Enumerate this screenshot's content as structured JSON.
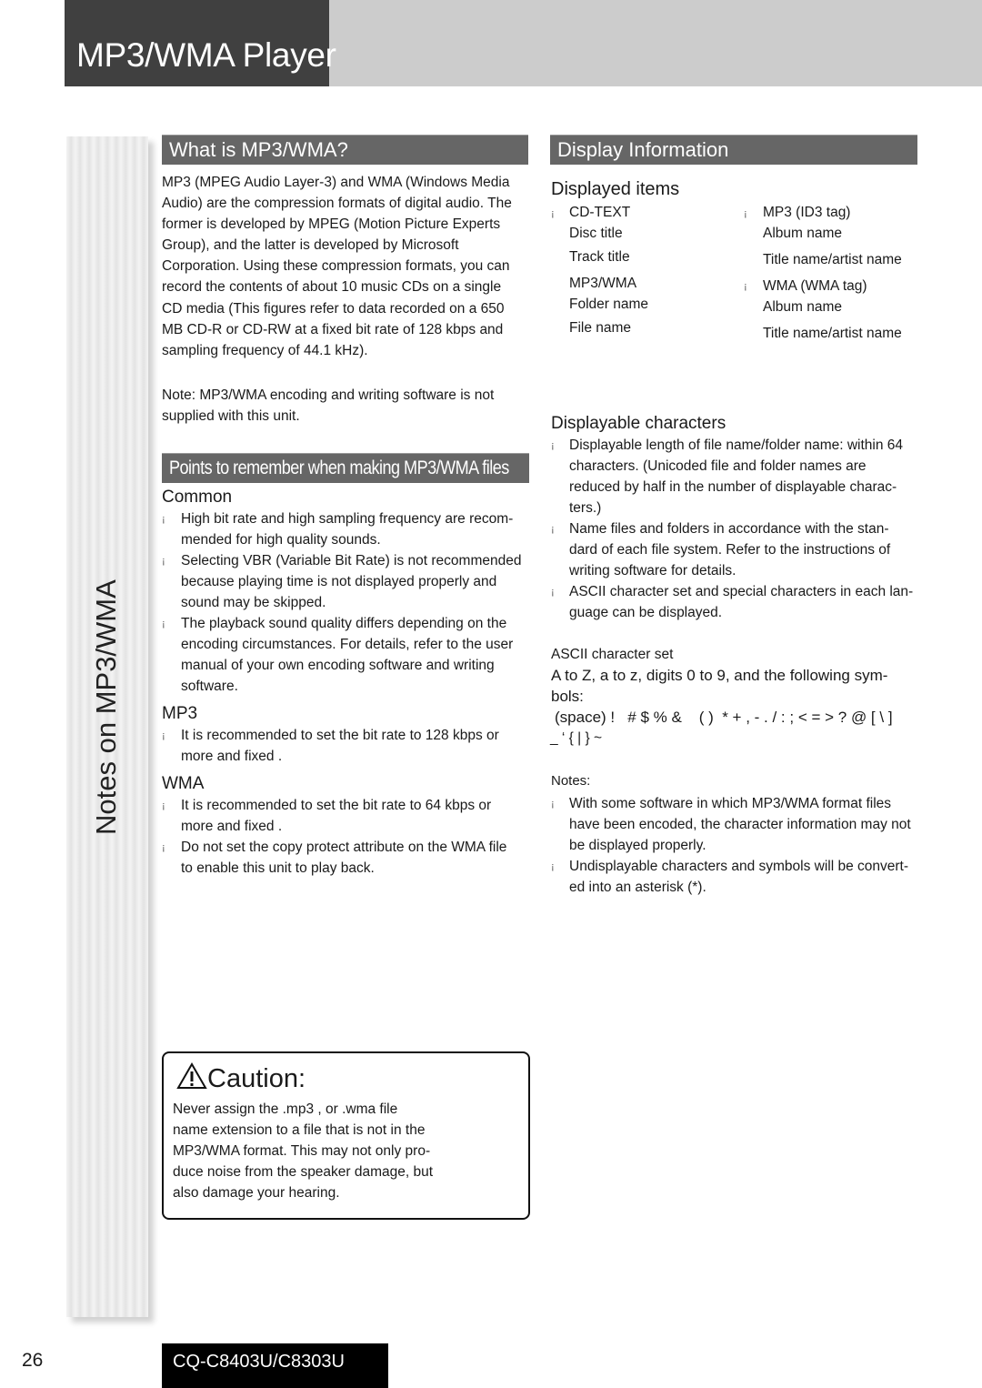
{
  "header": {
    "title": "MP3/WMA Player"
  },
  "sidebar": {
    "label": "Notes on MP3/WMA"
  },
  "what_is": {
    "heading": "What is MP3/WMA?",
    "paragraph": "MP3 (MPEG Audio Layer-3) and WMA (Windows Media\nAudio) are the compression formats of digital audio. The\nformer is developed by MPEG (Motion Picture Experts\nGroup), and the latter is developed by Microsoft\nCorporation. Using these compression formats, you can\nrecord the contents of about 10 music CDs on a single\nCD media (This figures refer to data recorded on a 650\nMB CD-R or CD-RW at a fixed bit rate of 128 kbps and\nsampling frequency of 44.1 kHz).",
    "trademark": "™",
    "note": "Note:  MP3/WMA encoding and writing software is not\nsupplied with this unit."
  },
  "points": {
    "heading": "Points to remember when making MP3/WMA files",
    "common": {
      "title": "Common",
      "items": [
        "High bit rate and high sampling frequency are recom-\nmended for high quality sounds.",
        "Selecting VBR (Variable Bit Rate) is not recommended\nbecause playing time is not displayed properly and\nsound may be skipped.",
        "The playback sound quality differs depending on the\nencoding circumstances. For details, refer to the user\nmanual of your own encoding software and writing\nsoftware."
      ]
    },
    "mp3": {
      "title": "MP3",
      "items": [
        "It is recommended to set the bit rate to  128 kbps or\nmore  and  fixed ."
      ]
    },
    "wma": {
      "title": "WMA",
      "items": [
        "It is recommended to set the bit rate to  64 kbps or\nmore  and  fixed .",
        "Do not set the copy protect attribute on the WMA file\nto enable this unit to play back."
      ]
    }
  },
  "display_info": {
    "heading": "Display Information",
    "displayed_items": {
      "title": "Displayed items",
      "left": [
        {
          "group": "CD-TEXT",
          "items": [
            "Disc title",
            "Track title"
          ]
        },
        {
          "group": "MP3/WMA",
          "items": [
            "Folder name",
            "File name"
          ]
        }
      ],
      "right": [
        {
          "group": "MP3 (ID3 tag)",
          "items": [
            "Album name",
            "Title name/artist name"
          ]
        },
        {
          "group": "WMA (WMA tag)",
          "items": [
            "Album name",
            "Title name/artist name"
          ]
        }
      ]
    },
    "displayable_chars": {
      "title": "Displayable characters",
      "items": [
        "Displayable length of file name/folder name: within 64\ncharacters. (Unicoded file and folder names are\nreduced by half in the number of displayable charac-\nters.)",
        "Name files and folders in accordance with the stan-\ndard of each file system. Refer to the instructions of\nwriting software for details.",
        "ASCII character set and special characters in each lan-\nguage can be displayed."
      ]
    },
    "ascii": {
      "title": "ASCII character set",
      "description": "A to Z, a to z, digits 0 to 9, and the following sym-\nbols:",
      "symbols_line1": "(space) !   # $ % &    ( )  * + , - . / : ; < = > ? @ [ \\ ]",
      "symbols_line2": "_ ‘ { | } ~"
    },
    "notes": {
      "title": "Notes:",
      "items": [
        "With some software in which MP3/WMA format files\nhave been encoded, the character information may not\nbe displayed properly.",
        "Undisplayable characters and symbols will be convert-\ned into an asterisk (*)."
      ]
    }
  },
  "caution": {
    "title": "Caution:",
    "text": "Never assign the  .mp3 , or  .wma  file\nname extension to a file that is not in the\nMP3/WMA format. This may not only pro-\nduce noise from the speaker damage, but\nalso damage your hearing."
  },
  "footer": {
    "page_number": "26",
    "model": "CQ-C8403U/C8303U"
  },
  "bullet_glyph": "¡"
}
